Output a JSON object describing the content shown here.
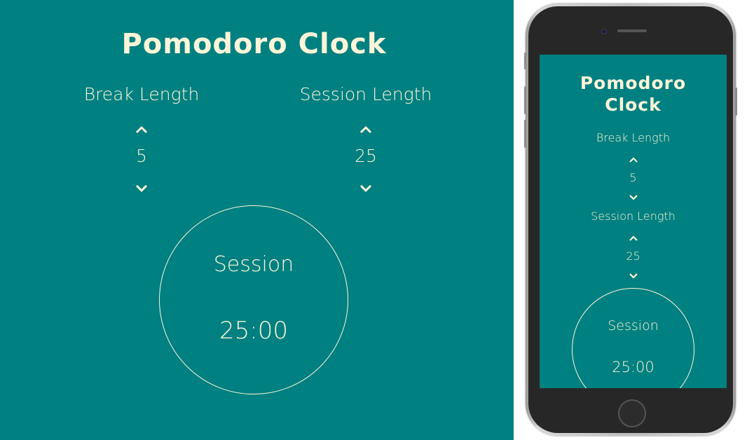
{
  "app": {
    "title": "Pomodoro Clock",
    "title_line1": "Pomodoro",
    "title_line2": "Clock"
  },
  "break": {
    "label": "Break Length",
    "value": "5"
  },
  "session": {
    "label": "Session Length",
    "value": "25"
  },
  "timer": {
    "mode": "Session",
    "time": "25:00"
  },
  "icons": {
    "increment": "chevron-up-icon",
    "decrement": "chevron-down-icon"
  },
  "colors": {
    "background": "#008080",
    "text": "#fdf5d8",
    "phone_frame": "#272727"
  }
}
